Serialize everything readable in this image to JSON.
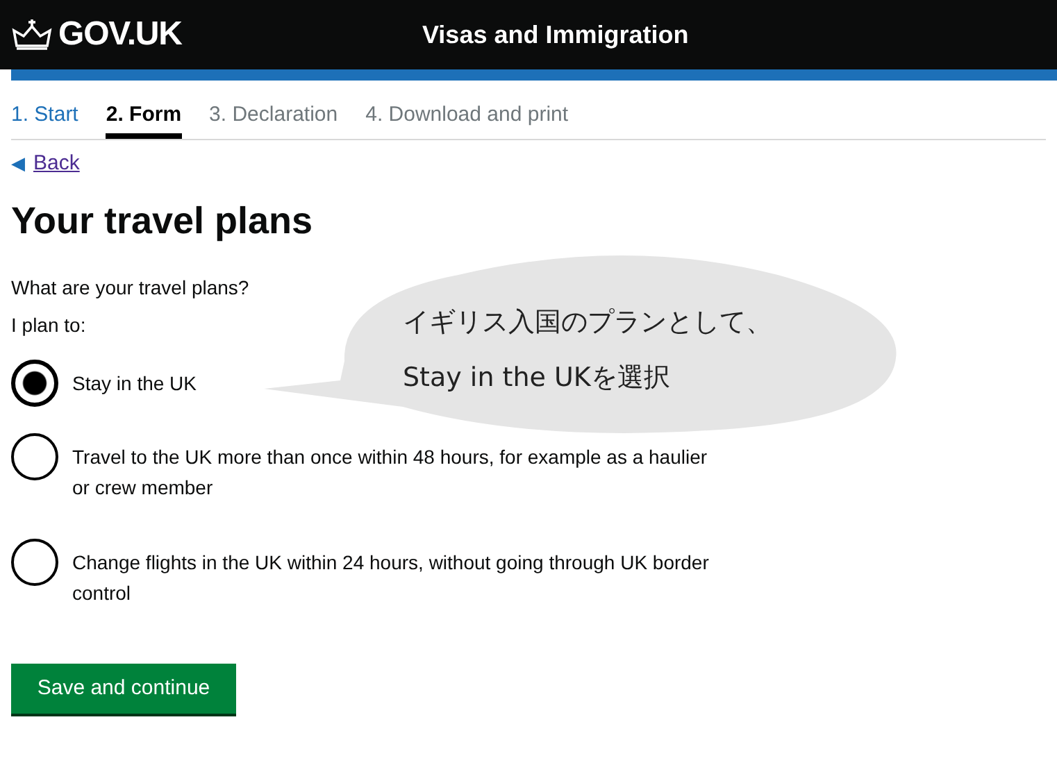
{
  "header": {
    "logo": "GOV.UK",
    "service": "Visas and Immigration"
  },
  "steps": [
    {
      "label": "1. Start",
      "selected": false,
      "kind": "done"
    },
    {
      "label": "2. Form",
      "selected": true,
      "kind": "current"
    },
    {
      "label": "3. Declaration",
      "selected": false,
      "kind": "todo"
    },
    {
      "label": "4. Download and print",
      "selected": false,
      "kind": "todo"
    }
  ],
  "back_link": {
    "arrow": "◀",
    "label": "Back"
  },
  "title": "Your travel plans",
  "question": "What are your travel plans?",
  "hint": "I plan to:",
  "options": [
    {
      "label": "Stay in the UK",
      "selected": true
    },
    {
      "label": "Travel to the UK more than once within 48 hours, for example as a haulier or crew member",
      "selected": false
    },
    {
      "label": "Change flights in the UK within 24 hours, without going through UK border control",
      "selected": false
    }
  ],
  "callout": {
    "lines": [
      "イギリス入国のプランとして、",
      "Stay in the UKを選択"
    ]
  },
  "button": "Save and continue"
}
